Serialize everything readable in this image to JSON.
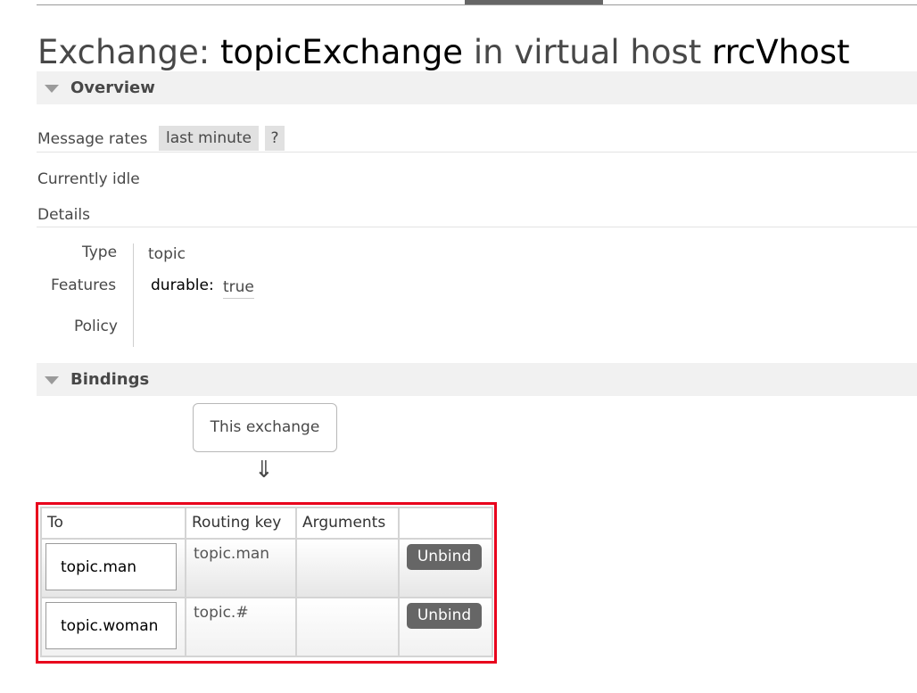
{
  "title": {
    "prefix": "Exchange:",
    "name": "topicExchange",
    "middle": "in virtual host",
    "vhost": "rrcVhost"
  },
  "overview": {
    "section_label": "Overview",
    "message_rates_label": "Message rates",
    "rate_period": "last minute",
    "help_label": "?",
    "status": "Currently idle",
    "details_label": "Details",
    "type_label": "Type",
    "type_value": "topic",
    "features_label": "Features",
    "feature_key": "durable:",
    "feature_value": "true",
    "policy_label": "Policy"
  },
  "bindings": {
    "section_label": "Bindings",
    "source_label": "This exchange",
    "arrow": "⇓",
    "columns": [
      "To",
      "Routing key",
      "Arguments",
      ""
    ],
    "rows": [
      {
        "to": "topic.man",
        "routing_key": "topic.man",
        "arguments": "",
        "action": "Unbind"
      },
      {
        "to": "topic.woman",
        "routing_key": "topic.#",
        "arguments": "",
        "action": "Unbind"
      }
    ]
  },
  "colors": {
    "highlight_frame": "#e8001c",
    "button_bg": "#666666",
    "section_bg": "#f1f1f1"
  }
}
